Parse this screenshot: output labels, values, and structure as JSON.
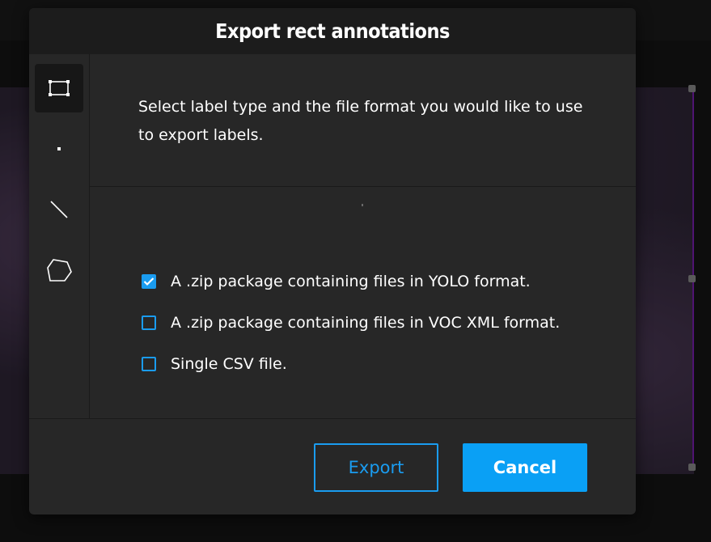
{
  "dialog": {
    "title": "Export rect annotations",
    "description": "Select label type and the file format you would like to use to export labels.",
    "label_types": [
      {
        "name": "rect",
        "icon": "rectangle-icon",
        "active": true
      },
      {
        "name": "point",
        "icon": "point-icon",
        "active": false
      },
      {
        "name": "line",
        "icon": "line-icon",
        "active": false
      },
      {
        "name": "polygon",
        "icon": "polygon-icon",
        "active": false
      }
    ],
    "options": [
      {
        "label": "A .zip package containing files in YOLO format.",
        "checked": true
      },
      {
        "label": "A .zip package containing files in VOC XML format.",
        "checked": false
      },
      {
        "label": "Single CSV file.",
        "checked": false
      }
    ],
    "buttons": {
      "export": "Export",
      "cancel": "Cancel"
    }
  },
  "colors": {
    "accent": "#1a9cf0",
    "dialog_bg": "#272727",
    "header_bg": "#1c1c1c"
  }
}
